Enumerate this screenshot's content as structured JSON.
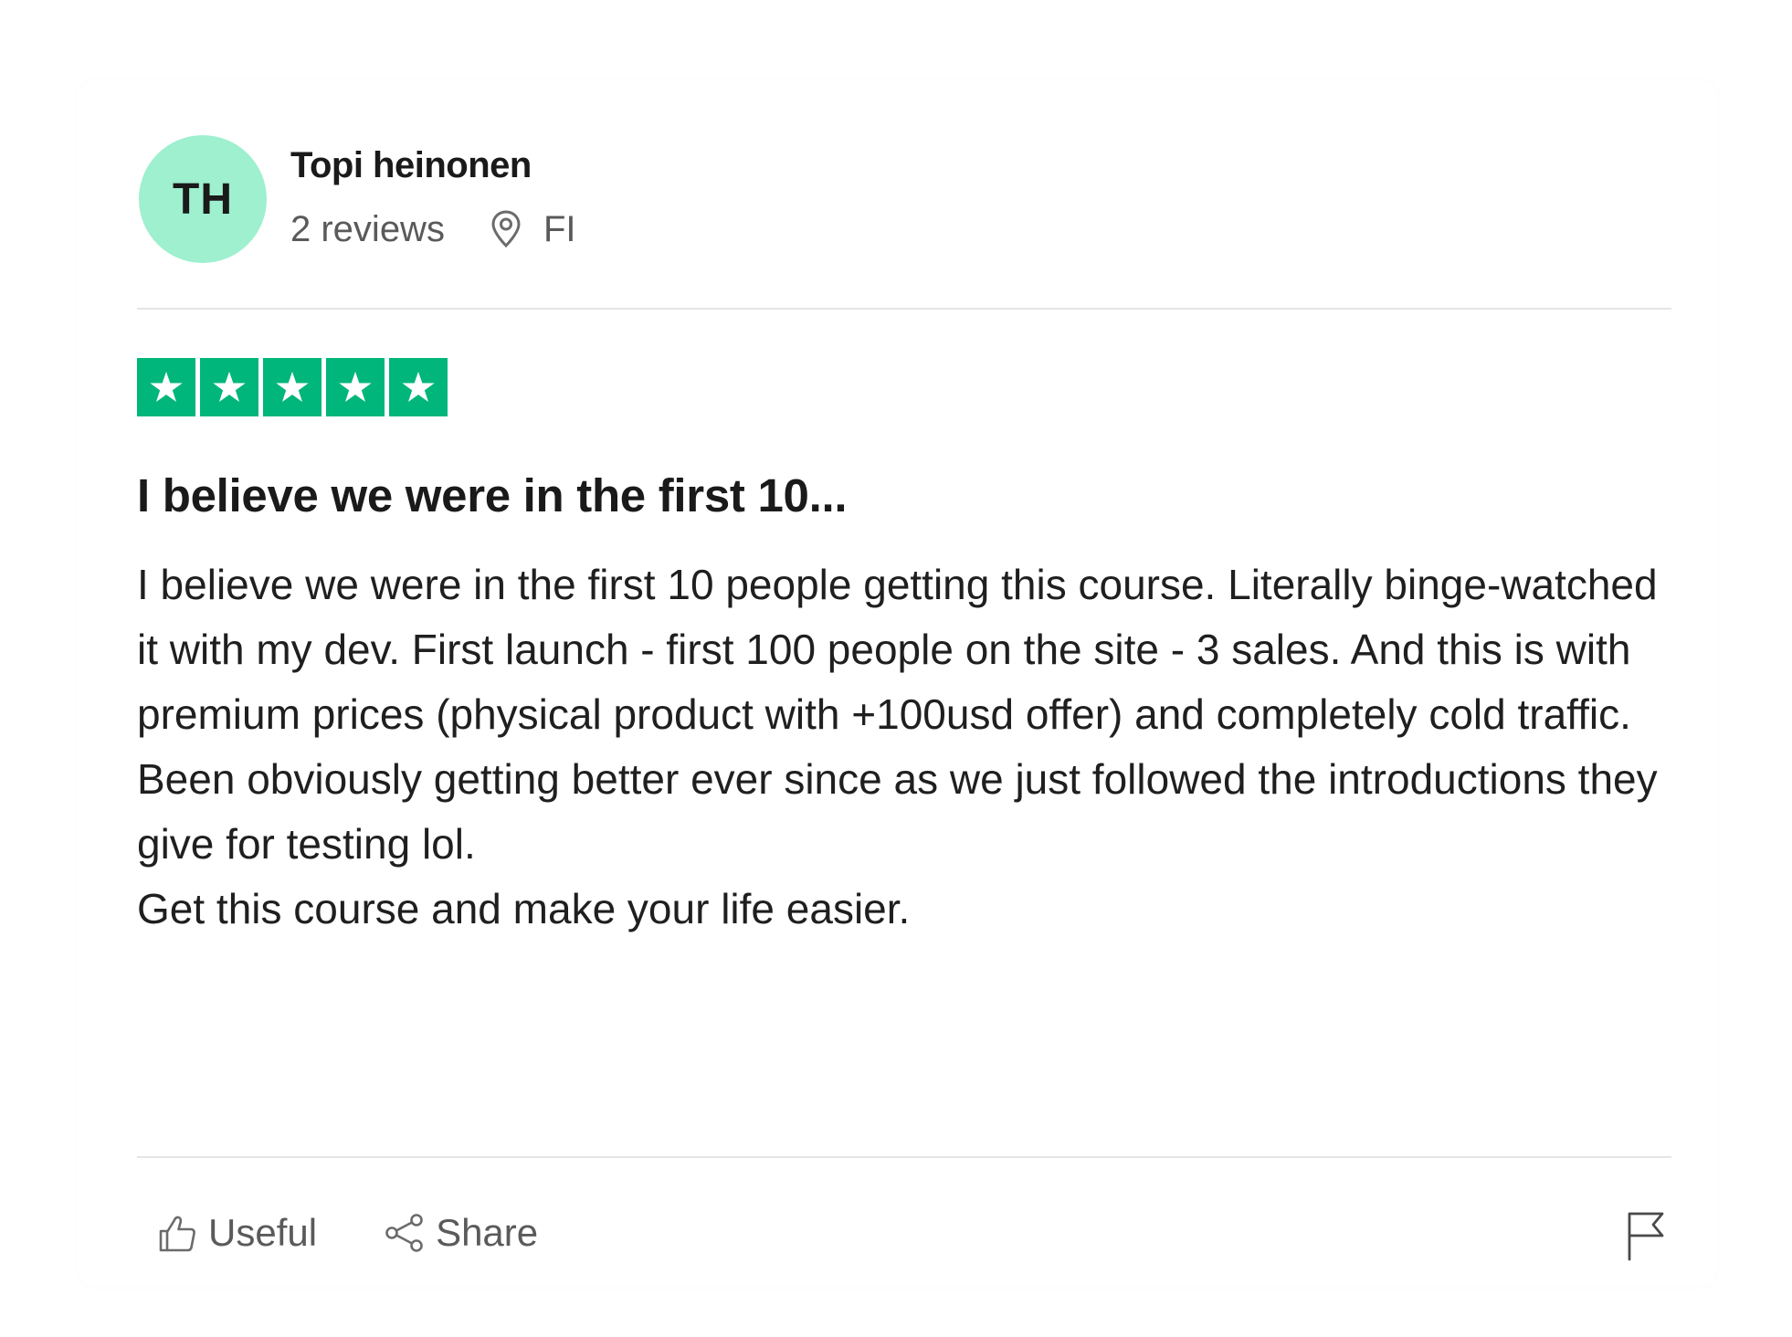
{
  "reviewer": {
    "initials": "TH",
    "avatar_color": "#9ef0cf",
    "name": "Topi heinonen",
    "reviews_count": "2 reviews",
    "location_icon": "location-pin-icon",
    "country": "FI"
  },
  "rating": {
    "stars": 5,
    "max_stars": 5,
    "star_color": "#00b67a"
  },
  "review": {
    "title": "I believe we were in the first 10...",
    "body_paragraph_1": "I believe we were in the first 10 people getting this course. Literally binge-watched it with my dev. First launch - first 100 people on the site - 3 sales. And this is with premium prices (physical product with +100usd offer) and completely cold traffic. Been obviously getting better ever since as we just followed the introductions they give for testing lol.",
    "body_paragraph_2": "Get this course and make your life easier."
  },
  "actions": {
    "useful_label": "Useful",
    "useful_icon": "thumbs-up-icon",
    "share_label": "Share",
    "share_icon": "share-icon",
    "report_icon": "flag-icon"
  }
}
